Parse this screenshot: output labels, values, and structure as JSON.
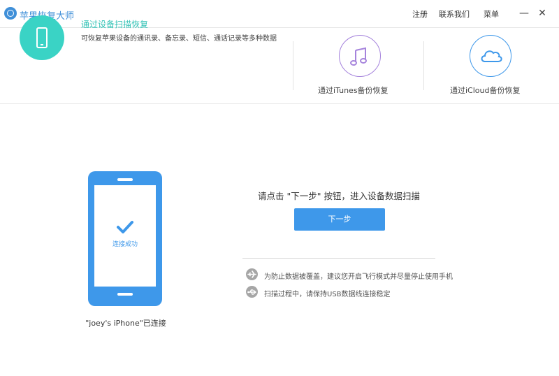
{
  "app": {
    "title": "苹果恢复大师"
  },
  "menu": {
    "register": "注册",
    "contact": "联系我们",
    "menu": "菜单",
    "minimize": "—",
    "close": "✕"
  },
  "modes": [
    {
      "title": "通过设备扫描恢复",
      "description": "可恢复苹果设备的通讯录、备忘录、短信、通话记录等多种数据",
      "icon": "phone-icon",
      "color": "#3ad3c5"
    },
    {
      "label": "通过iTunes备份恢复",
      "icon": "music-note-icon",
      "color": "#a583dc"
    },
    {
      "label": "通过iCloud备份恢复",
      "icon": "cloud-icon",
      "color": "#3e98ea"
    }
  ],
  "device": {
    "status": "连接成功",
    "name_label": "\"joey's iPhone\"已连接"
  },
  "main": {
    "instruction": "请点击 \"下一步\" 按钮，进入设备数据扫描",
    "next_button": "下一步"
  },
  "tips": [
    {
      "icon": "airplane-icon",
      "text": "为防止数据被覆盖，建议您开启飞行模式并尽量停止使用手机"
    },
    {
      "icon": "usb-icon",
      "text": "扫描过程中，请保持USB数据线连接稳定"
    }
  ],
  "colors": {
    "accent": "#3e98ea",
    "teal": "#3ad3c5",
    "purple": "#a583dc"
  }
}
